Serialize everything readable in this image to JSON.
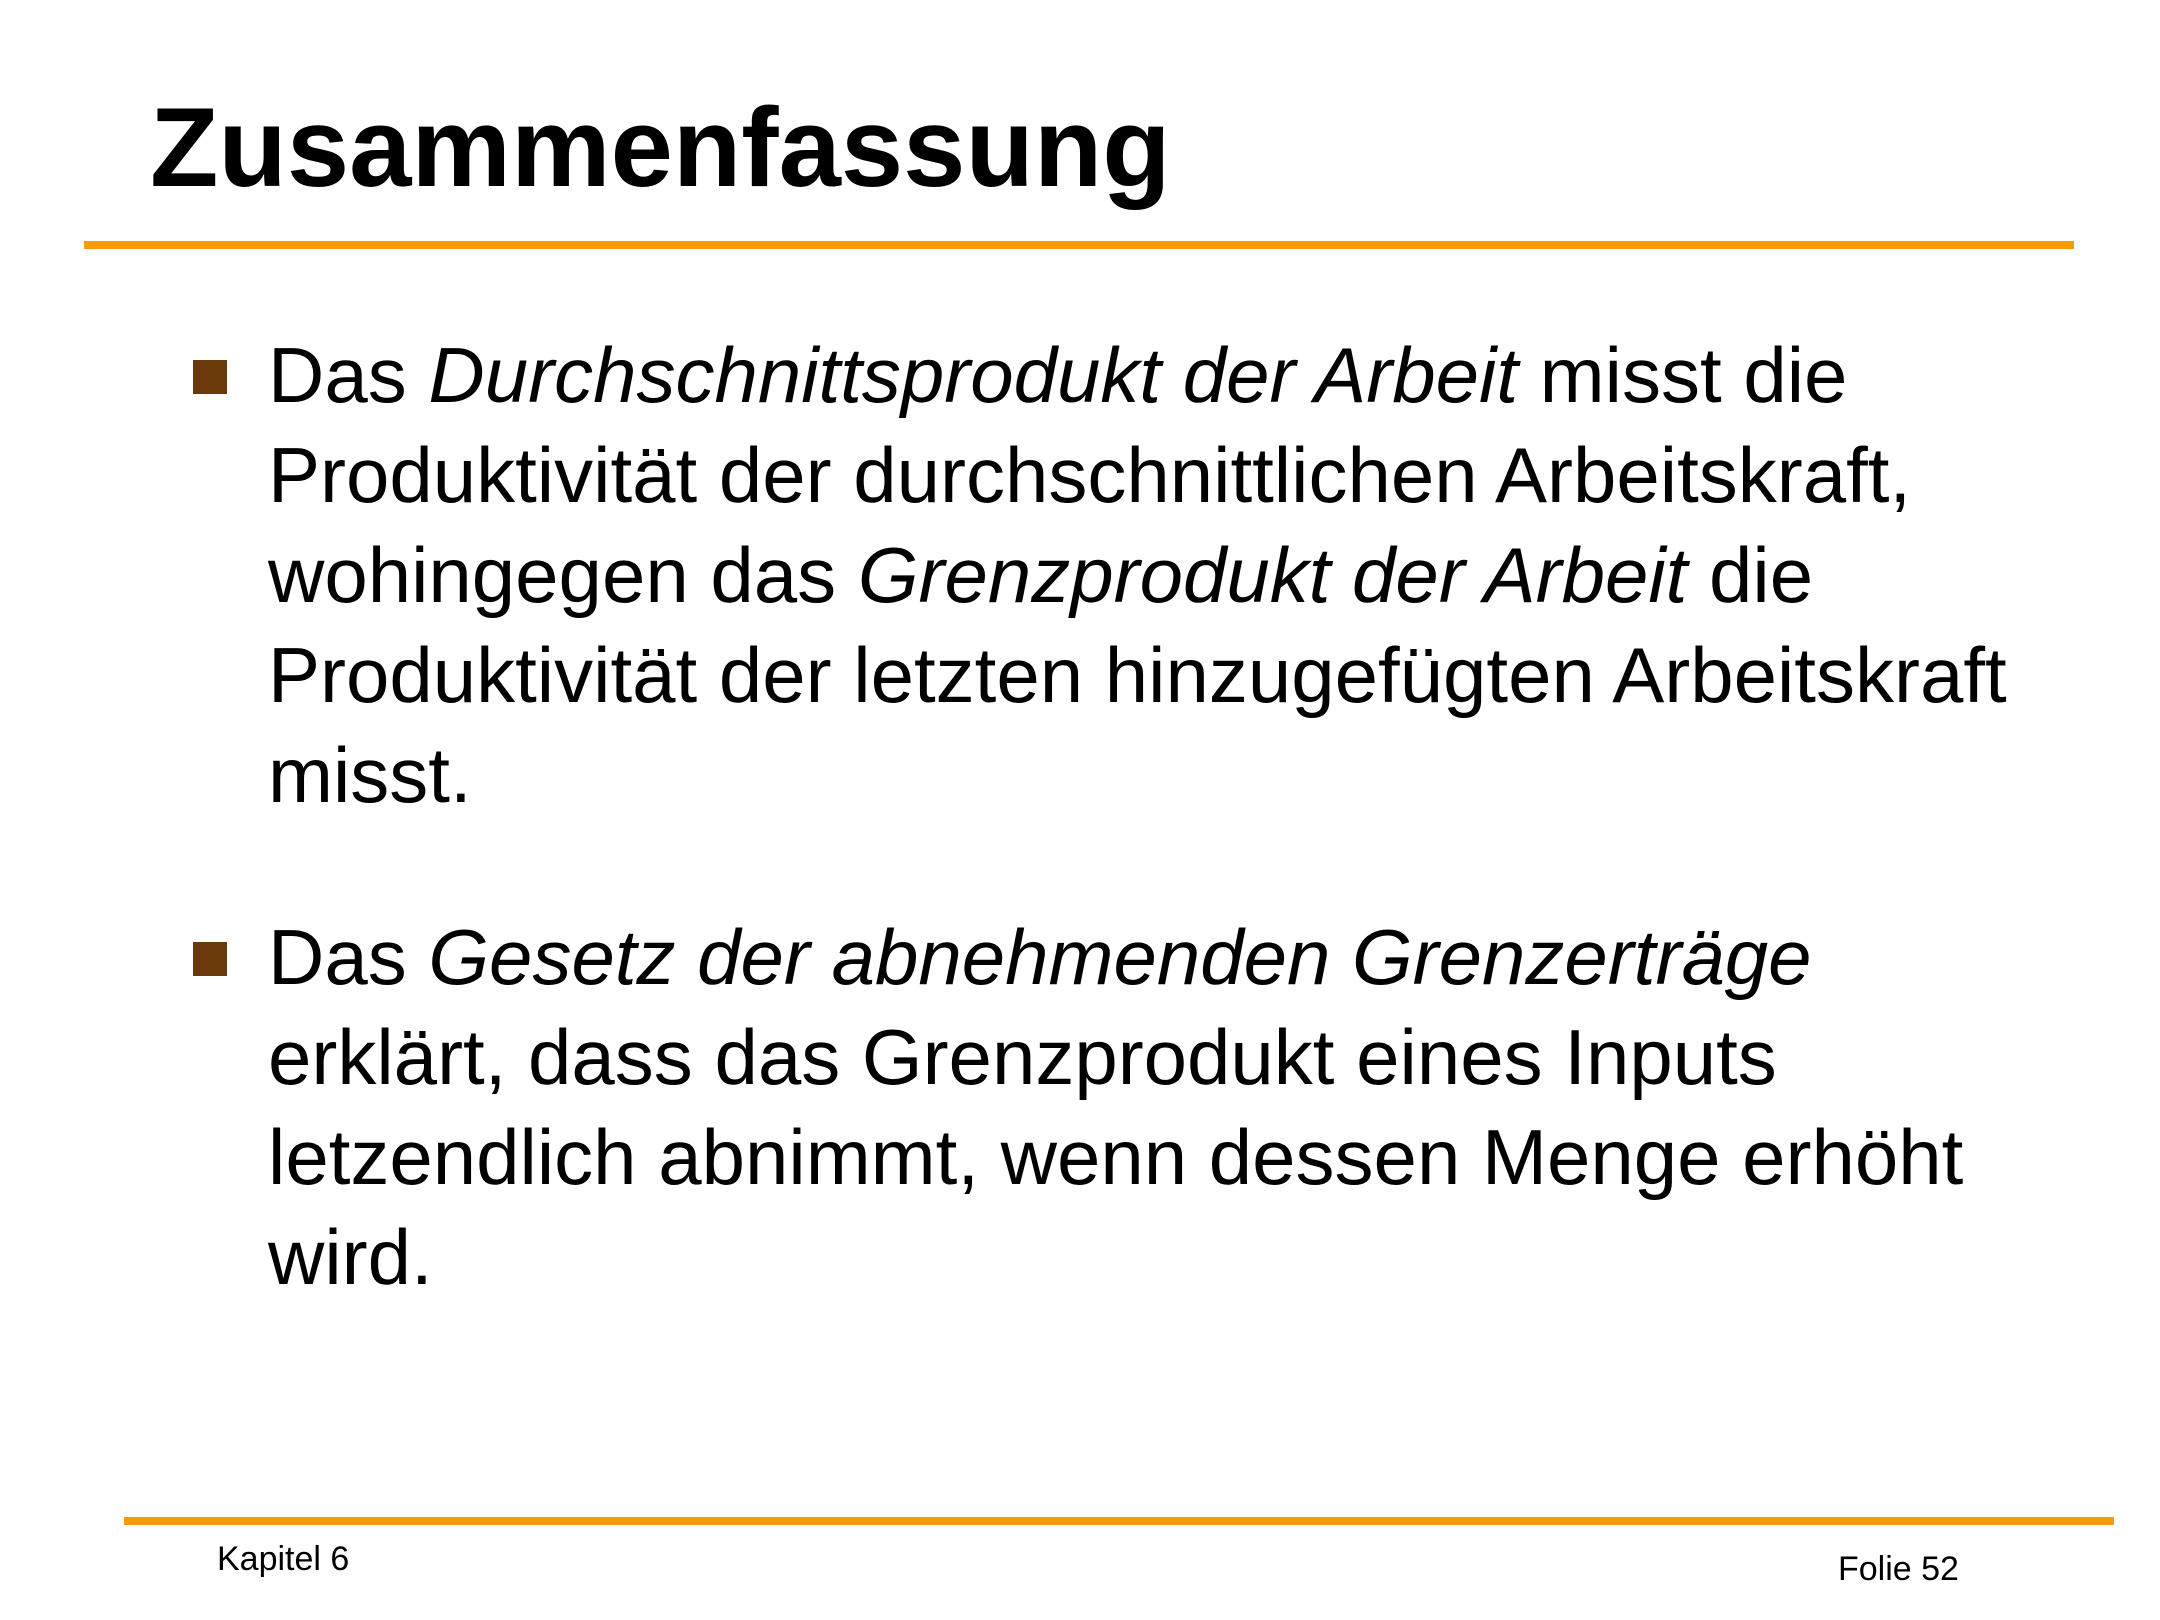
{
  "slide": {
    "title": "Zusammenfassung",
    "bullets": [
      {
        "parts": [
          "Das ",
          "Durchschnittsprodukt der Arbeit",
          " misst die Produktivität der durchschnittlichen Arbeitskraft, wohingegen das ",
          "Grenzprodukt der Arbeit",
          " die Produktivität der letzten hinzugefügten Arbeitskraft misst."
        ]
      },
      {
        "parts": [
          "Das ",
          "Gesetz der abnehmenden Grenzerträge",
          " erklärt, dass das Grenzprodukt eines Inputs letzendlich abnimmt, wenn dessen Menge erhöht wird."
        ]
      }
    ]
  },
  "footer": {
    "chapter": "Kapitel 6",
    "slide_number": "Folie 52"
  },
  "colors": {
    "accent_rule": "#f59c0d",
    "bullet_marker": "#6b3a0a",
    "text": "#000000",
    "background": "#ffffff"
  }
}
